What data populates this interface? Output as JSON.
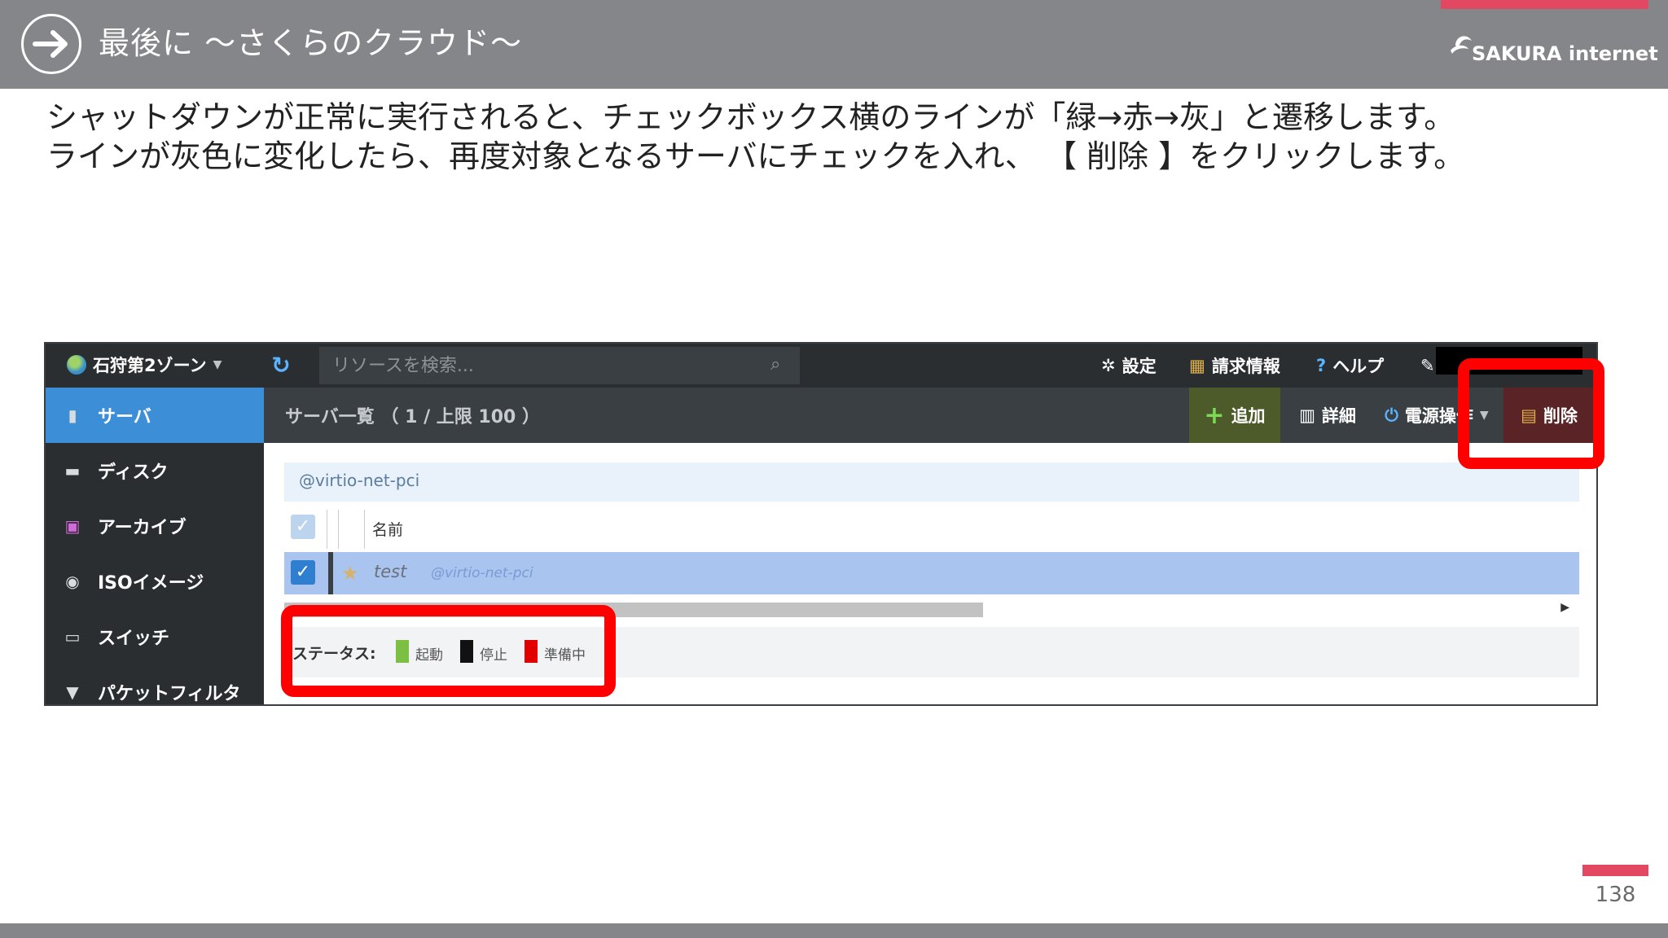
{
  "header": {
    "title": "最後に ～さくらのクラウド～",
    "logo_text": "SAKURA internet",
    "arrow_icon": "arrow-right-icon"
  },
  "description": {
    "line1": "シャットダウンが正常に実行されると、チェックボックス横のラインが「緑→赤→灰」と遷移します。",
    "line2": "ラインが灰色に変化したら、再度対象となるサーバにチェックを入れ、 【 削除 】をクリックします。"
  },
  "console": {
    "zone": "石狩第2ゾーン",
    "search_placeholder": "リソースを検索...",
    "topnav": [
      {
        "label": "設定",
        "icon": "gear-icon"
      },
      {
        "label": "請求情報",
        "icon": "billing-icon"
      },
      {
        "label": "ヘルプ",
        "icon": "help-icon"
      }
    ],
    "sidebar": [
      {
        "label": "サーバ",
        "icon": "server-icon",
        "active": true
      },
      {
        "label": "ディスク",
        "icon": "disk-icon",
        "active": false
      },
      {
        "label": "アーカイブ",
        "icon": "archive-icon",
        "active": false
      },
      {
        "label": "ISOイメージ",
        "icon": "iso-icon",
        "active": false
      },
      {
        "label": "スイッチ",
        "icon": "switch-icon",
        "active": false
      },
      {
        "label": "パケットフィルタ",
        "icon": "filter-icon",
        "active": false
      }
    ],
    "list_title": "サーバ一覧 （ 1 / 上限 100 ）",
    "toolbar": {
      "add": "追加",
      "detail": "詳細",
      "power": "電源操作",
      "delete": "削除"
    },
    "filter": "@virtio-net-pci",
    "table": {
      "column_name": "名前",
      "rows": [
        {
          "name": "test",
          "tag": "@virtio-net-pci",
          "checked": true
        }
      ]
    },
    "status_legend": {
      "label": "ステータス:",
      "items": [
        {
          "label": "起動",
          "color": "#7bc043"
        },
        {
          "label": "停止",
          "color": "#111111"
        },
        {
          "label": "準備中",
          "color": "#e00000"
        }
      ]
    }
  },
  "page_number": "138",
  "colors": {
    "accent": "#e24862",
    "header_bg": "#858689",
    "highlight": "#ff0000"
  }
}
